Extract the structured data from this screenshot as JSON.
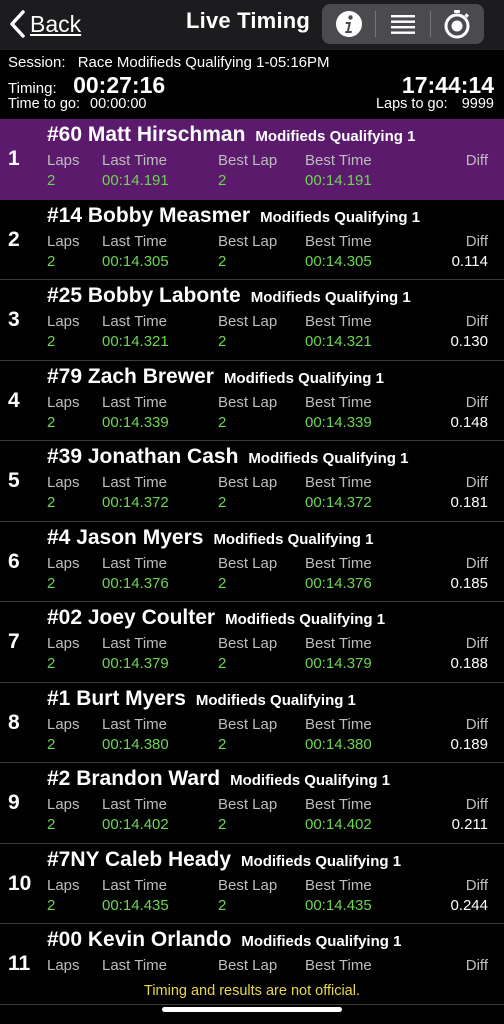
{
  "nav": {
    "back_label": "Back",
    "title": "Live Timing",
    "info_icon": "info-icon",
    "menu_icon": "list-icon",
    "timer_icon": "stopwatch-icon"
  },
  "session": {
    "session_label": "Session:",
    "session_name": "Race Modifieds Qualifying 1-05:16PM",
    "timing_label": "Timing:",
    "elapsed": "00:27:16",
    "clock": "17:44:14",
    "time_to_go_label": "Time to go:",
    "time_to_go": "00:00:00",
    "laps_to_go_label": "Laps to go:",
    "laps_to_go": "9999"
  },
  "column_labels": {
    "laps": "Laps",
    "last_time": "Last Time",
    "best_lap": "Best Lap",
    "best_time": "Best Time",
    "diff": "Diff"
  },
  "entries": [
    {
      "pos": "1",
      "name": "#60 Matt Hirschman",
      "cls": "Modifieds Qualifying 1",
      "laps": "2",
      "last_time": "00:14.191",
      "best_lap": "2",
      "best_time": "00:14.191",
      "diff": ""
    },
    {
      "pos": "2",
      "name": "#14 Bobby Measmer",
      "cls": "Modifieds Qualifying 1",
      "laps": "2",
      "last_time": "00:14.305",
      "best_lap": "2",
      "best_time": "00:14.305",
      "diff": "0.114"
    },
    {
      "pos": "3",
      "name": "#25 Bobby Labonte",
      "cls": "Modifieds Qualifying 1",
      "laps": "2",
      "last_time": "00:14.321",
      "best_lap": "2",
      "best_time": "00:14.321",
      "diff": "0.130"
    },
    {
      "pos": "4",
      "name": "#79 Zach Brewer",
      "cls": "Modifieds Qualifying 1",
      "laps": "2",
      "last_time": "00:14.339",
      "best_lap": "2",
      "best_time": "00:14.339",
      "diff": "0.148"
    },
    {
      "pos": "5",
      "name": "#39 Jonathan Cash",
      "cls": "Modifieds Qualifying 1",
      "laps": "2",
      "last_time": "00:14.372",
      "best_lap": "2",
      "best_time": "00:14.372",
      "diff": "0.181"
    },
    {
      "pos": "6",
      "name": "#4 Jason Myers",
      "cls": "Modifieds Qualifying 1",
      "laps": "2",
      "last_time": "00:14.376",
      "best_lap": "2",
      "best_time": "00:14.376",
      "diff": "0.185"
    },
    {
      "pos": "7",
      "name": "#02 Joey Coulter",
      "cls": "Modifieds Qualifying 1",
      "laps": "2",
      "last_time": "00:14.379",
      "best_lap": "2",
      "best_time": "00:14.379",
      "diff": "0.188"
    },
    {
      "pos": "8",
      "name": "#1 Burt Myers",
      "cls": "Modifieds Qualifying 1",
      "laps": "2",
      "last_time": "00:14.380",
      "best_lap": "2",
      "best_time": "00:14.380",
      "diff": "0.189"
    },
    {
      "pos": "9",
      "name": "#2 Brandon Ward",
      "cls": "Modifieds Qualifying 1",
      "laps": "2",
      "last_time": "00:14.402",
      "best_lap": "2",
      "best_time": "00:14.402",
      "diff": "0.211"
    },
    {
      "pos": "10",
      "name": "#7NY Caleb Heady",
      "cls": "Modifieds Qualifying 1",
      "laps": "2",
      "last_time": "00:14.435",
      "best_lap": "2",
      "best_time": "00:14.435",
      "diff": "0.244"
    },
    {
      "pos": "11",
      "name": "#00 Kevin Orlando",
      "cls": "Modifieds Qualifying 1",
      "laps": "",
      "last_time": "",
      "best_lap": "",
      "best_time": "",
      "diff": ""
    }
  ],
  "footer": {
    "notice": "Timing and results are not official."
  },
  "colors": {
    "leader_bg": "#5b1a6b",
    "value_green": "#6cd652",
    "notice_yellow": "#e8d84b"
  }
}
